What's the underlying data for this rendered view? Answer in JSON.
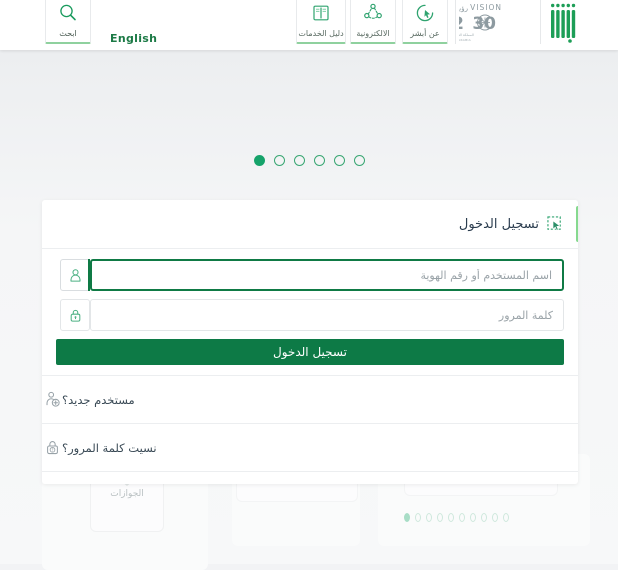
{
  "header": {
    "search": {
      "label": "ابحث",
      "icon": "search-icon"
    },
    "language_toggle": "English",
    "nav": [
      {
        "label": "عن أبشر",
        "icon": "cursor-circle-icon"
      },
      {
        "label": "الالكترونية",
        "icon": "network-nodes-icon"
      },
      {
        "label": "دليل الخدمات",
        "icon": "open-book-icon"
      }
    ],
    "vision_logo": {
      "title": "VISION",
      "title_ar": "رؤية",
      "year": "2030",
      "subtitle_ar": "المملكة العربية السعودية",
      "subtitle_en": "KINGDOM OF SAUDI ARABIA"
    },
    "moi_logo": "absher-ministry-of-interior-logo"
  },
  "carousel": {
    "dots": [
      "1",
      "2",
      "3",
      "4",
      "5",
      "6"
    ],
    "active_index": 5
  },
  "login_card": {
    "title": "تسجيل الدخول",
    "title_icon": "cursor-select-icon",
    "username": {
      "placeholder": "اسم المستخدم أو رقم الهوية",
      "value": "",
      "icon": "user-icon",
      "focused": true
    },
    "password": {
      "placeholder": "كلمة المرور",
      "value": "",
      "icon": "lock-icon",
      "focused": false
    },
    "submit_label": "تسجيل الدخول",
    "links": [
      {
        "label": "مستخدم جديد؟",
        "icon": "user-add-icon"
      },
      {
        "label": "نسيت كلمة المرور؟",
        "icon": "lock-question-icon"
      }
    ]
  },
  "background": {
    "service_label": "الجوازات",
    "service_icon": "passport-emblem-icon",
    "pager_dots": [
      "1",
      "2",
      "3",
      "4",
      "5",
      "6",
      "7",
      "8",
      "9",
      "10"
    ],
    "pager_active_index": 9
  },
  "colors": {
    "brand_green": "#0d7a46",
    "accent_green": "#16a36a",
    "light_green": "#86d98f",
    "title_navy": "#2b3d4f",
    "page_bg": "#f2f3f5"
  }
}
